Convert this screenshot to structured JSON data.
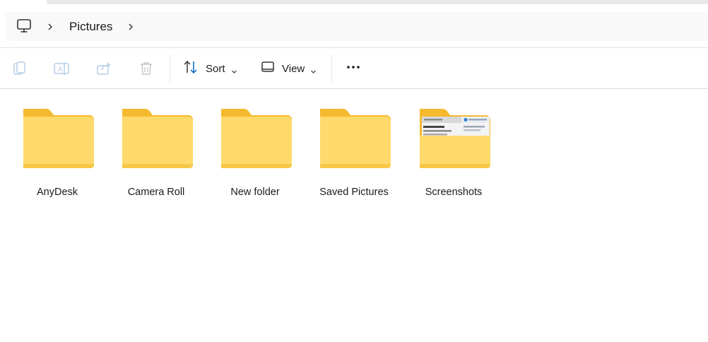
{
  "address_bar": {
    "root_icon": "computer-icon",
    "breadcrumb": [
      "Pictures"
    ]
  },
  "toolbar": {
    "copy_icon": "copy-icon",
    "rename_icon": "rename-icon",
    "share_icon": "share-icon",
    "delete_icon": "delete-icon",
    "sort_label": "Sort",
    "view_label": "View",
    "more_icon": "more-icon"
  },
  "folders": [
    {
      "name": "AnyDesk",
      "icon": "folder-icon"
    },
    {
      "name": "Camera Roll",
      "icon": "folder-icon"
    },
    {
      "name": "New folder",
      "icon": "folder-icon"
    },
    {
      "name": "Saved Pictures",
      "icon": "folder-icon"
    },
    {
      "name": "Screenshots",
      "icon": "folder-with-preview-icon"
    }
  ],
  "colors": {
    "folder_back": "#f5b92e",
    "folder_front": "#ffd96b",
    "accent": "#0067c0"
  }
}
